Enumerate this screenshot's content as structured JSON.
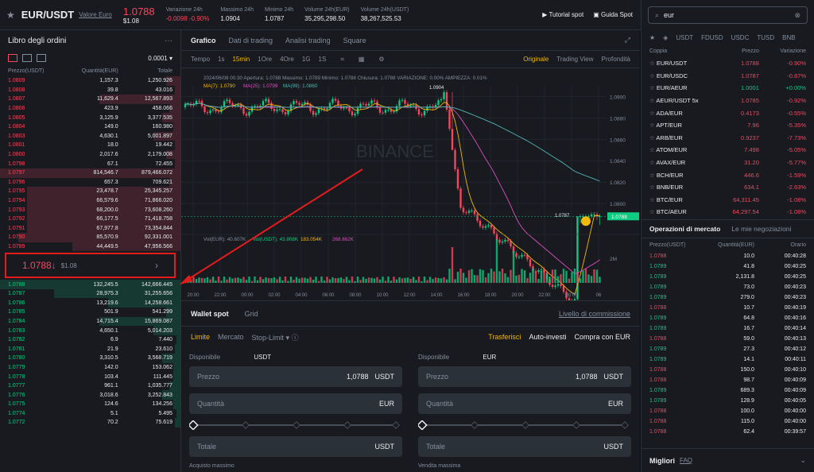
{
  "header": {
    "pair": "EUR/USDT",
    "pair_sub": "Valore Euro",
    "price": "1.0788",
    "price_usd": "$1.08",
    "stats": [
      {
        "label": "Variazione 24h",
        "value": "-0.0098 -0.90%",
        "color": "red"
      },
      {
        "label": "Massimo 24h",
        "value": "1.0904",
        "color": ""
      },
      {
        "label": "Minimo 24h",
        "value": "1.0787",
        "color": ""
      },
      {
        "label": "Volume 24h(EUR)",
        "value": "35,295,298.50",
        "color": ""
      },
      {
        "label": "Volume 24h(USDT)",
        "value": "38,267,525.53",
        "color": ""
      }
    ],
    "tutorial": "Tutorial spot",
    "guide": "Guida Spot"
  },
  "orderbook": {
    "title": "Libro degli ordini",
    "precision": "0.0001",
    "col_price": "Prezzo(USDT)",
    "col_qty": "Quantità(EUR)",
    "col_total": "Totale",
    "asks": [
      [
        "1.0809",
        "1,157.3",
        "1,250.926",
        8
      ],
      [
        "1.0808",
        "39.8",
        "43.016",
        3
      ],
      [
        "1.0807",
        "11,629.4",
        "12,567.893",
        45
      ],
      [
        "1.0806",
        "423.9",
        "458.066",
        6
      ],
      [
        "1.0805",
        "3,125.9",
        "3,377.535",
        10
      ],
      [
        "1.0804",
        "149.0",
        "160.980",
        4
      ],
      [
        "1.0803",
        "4,630.1",
        "5,001.897",
        15
      ],
      [
        "1.0801",
        "18.0",
        "19.442",
        3
      ],
      [
        "1.0800",
        "2,017.6",
        "2,179.008",
        8
      ],
      [
        "1.0798",
        "67.1",
        "72.455",
        3
      ],
      [
        "1.0797",
        "814,546.7",
        "879,466.072",
        100
      ],
      [
        "1.0796",
        "657.3",
        "709.621",
        6
      ],
      [
        "1.0795",
        "23,478.7",
        "25,345.257",
        85
      ],
      [
        "1.0794",
        "66,579.6",
        "71,866.020",
        85
      ],
      [
        "1.0793",
        "68,200.0",
        "73,608.260",
        85
      ],
      [
        "1.0792",
        "66,177.5",
        "71,418.758",
        85
      ],
      [
        "1.0791",
        "67,977.8",
        "73,354.844",
        85
      ],
      [
        "1.0790",
        "85,570.9",
        "92,331.001",
        90
      ],
      [
        "1.0789",
        "44,449.5",
        "47,956.566",
        60
      ]
    ],
    "mid_price": "1.0788",
    "mid_arrow": "↓",
    "mid_usd": "$1.08",
    "bids": [
      [
        "1.0788",
        "132,245.5",
        "142,666.445",
        100
      ],
      [
        "1.0787",
        "28,975.3",
        "31,255.656",
        70
      ],
      [
        "1.0786",
        "13,219.6",
        "14,258.661",
        40
      ],
      [
        "1.0785",
        "501.9",
        "541.299",
        8
      ],
      [
        "1.0784",
        "14,715.4",
        "15,869.087",
        45
      ],
      [
        "1.0783",
        "4,650.1",
        "5,014.203",
        15
      ],
      [
        "1.0782",
        "6.9",
        "7.440",
        2
      ],
      [
        "1.0781",
        "21.9",
        "23.610",
        3
      ],
      [
        "1.0780",
        "3,310.5",
        "3,568.719",
        10
      ],
      [
        "1.0779",
        "142.0",
        "153.062",
        4
      ],
      [
        "1.0778",
        "103.4",
        "111.445",
        4
      ],
      [
        "1.0777",
        "961.1",
        "1,035.777",
        6
      ],
      [
        "1.0776",
        "3,018.6",
        "3,252.843",
        10
      ],
      [
        "1.0775",
        "124.6",
        "134.256",
        4
      ],
      [
        "1.0774",
        "5.1",
        "5.495",
        2
      ],
      [
        "1.0772",
        "70.2",
        "75.619",
        3
      ]
    ]
  },
  "chart_panel": {
    "tabs": [
      "Grafico",
      "Dati di trading",
      "Analisi trading",
      "Square"
    ],
    "intervals": [
      "Tempo",
      "1s",
      "15min",
      "1Ore",
      "4Ore",
      "1G",
      "1S"
    ],
    "views": [
      "Originale",
      "Trading View",
      "Profondità"
    ],
    "ohlc_line": "2024/06/08 00:30  Apertura: 1.0788  Massimo: 1.0789  Minimo: 1.0788  Chiusura: 1.0788  VARIAZIONE: 0.00%  AMPIEZZA: 0.01%",
    "ma_line": [
      "MA(7): 1.0790",
      "MA(25): 1.0799",
      "MA(99): 1.0860"
    ],
    "vol_line": [
      "Vol(EUR): 40.607K",
      "Vol(USDT): 43.808K",
      "183.054K",
      "268.862K"
    ],
    "watermark": "BINANCE",
    "price_ticks": [
      "1.0900",
      "1.0880",
      "1.0860",
      "1.0840",
      "1.0820",
      "1.0800"
    ],
    "last_price_tag": "1.0788",
    "high_label": "1.0904",
    "low_label": "1.0787",
    "vol_tick": "2M",
    "time_ticks": [
      "20:00",
      "22:00",
      "00:00",
      "02:00",
      "04:00",
      "06:00",
      "08:00",
      "10:00",
      "12:00",
      "14:00",
      "16:00",
      "18:00",
      "20:00",
      "22:00",
      "00:00",
      "06"
    ]
  },
  "chart_data": {
    "type": "line",
    "series": [],
    "ma_colors": {
      "ma7": "#f0b90b",
      "ma25": "#d84fbd",
      "ma99": "#4fb6b1"
    }
  },
  "trade": {
    "tabs": [
      "Wallet spot",
      "Grid"
    ],
    "commission": "Livello di commissione",
    "order_types": [
      "Limite",
      "Mercato",
      "Stop-Limit"
    ],
    "transfer": "Trasferisci",
    "auto": "Auto-investi",
    "buy_eur": "Compra con EUR",
    "buy": {
      "avail_label": "Disponibile",
      "avail_unit": "USDT",
      "price_label": "Prezzo",
      "price": "1,0788",
      "price_unit": "USDT",
      "qty_label": "Quantità",
      "qty_unit": "EUR",
      "total_label": "Totale",
      "total_unit": "USDT",
      "max_label": "Acquisto massimo"
    },
    "sell": {
      "avail_label": "Disponibile",
      "avail_unit": "EUR",
      "price_label": "Prezzo",
      "price": "1,0788",
      "price_unit": "USDT",
      "qty_label": "Quantità",
      "qty_unit": "EUR",
      "total_label": "Totale",
      "total_unit": "USDT",
      "max_label": "Vendita massima"
    }
  },
  "market": {
    "search": "eur",
    "tabs": [
      "USDT",
      "FDUSD",
      "USDC",
      "TUSD",
      "BNB"
    ],
    "col_pair": "Coppia",
    "col_price": "Prezzo",
    "col_change": "Variazione",
    "rows": [
      [
        "EUR/USDT",
        "1.0788",
        "-0.90%",
        "red"
      ],
      [
        "EUR/USDC",
        "1.0787",
        "-0.87%",
        "red"
      ],
      [
        "EUR/AEUR",
        "1.0001",
        "+0.00%",
        "green"
      ],
      [
        "AEUR/USDT 5x",
        "1.0785",
        "-0.92%",
        "red"
      ],
      [
        "ADA/EUR",
        "0.4173",
        "-0.55%",
        "red"
      ],
      [
        "APT/EUR",
        "7.96",
        "-5.35%",
        "red"
      ],
      [
        "ARB/EUR",
        "0.9237",
        "-7.73%",
        "red"
      ],
      [
        "ATOM/EUR",
        "7.498",
        "-5.05%",
        "red"
      ],
      [
        "AVAX/EUR",
        "31.20",
        "-5.77%",
        "red"
      ],
      [
        "BCH/EUR",
        "446.6",
        "-1.59%",
        "red"
      ],
      [
        "BNB/EUR",
        "634.1",
        "-2.63%",
        "red"
      ],
      [
        "BTC/EUR",
        "64,311.45",
        "-1.08%",
        "red"
      ],
      [
        "BTC/AEUR",
        "64,297.54",
        "-1.08%",
        "red"
      ]
    ],
    "trades_tabs": [
      "Operazioni di mercato",
      "Le mie negoziazioni"
    ],
    "trades_cols": [
      "Prezzo(USDT)",
      "Quantità(EUR)",
      "Orario"
    ],
    "trades": [
      [
        "1.0788",
        "10.0",
        "00:40:28",
        "red"
      ],
      [
        "1.0789",
        "41.8",
        "00:40:25",
        "green"
      ],
      [
        "1.0789",
        "2,131.8",
        "00:40:25",
        "green"
      ],
      [
        "1.0789",
        "73.0",
        "00:40:23",
        "green"
      ],
      [
        "1.0789",
        "279.0",
        "00:40:23",
        "green"
      ],
      [
        "1.0788",
        "10.7",
        "00:40:19",
        "red"
      ],
      [
        "1.0789",
        "64.8",
        "00:40:16",
        "green"
      ],
      [
        "1.0789",
        "16.7",
        "00:40:14",
        "green"
      ],
      [
        "1.0788",
        "59.0",
        "00:40:13",
        "red"
      ],
      [
        "1.0789",
        "27.3",
        "00:40:12",
        "green"
      ],
      [
        "1.0789",
        "14.1",
        "00:40:11",
        "green"
      ],
      [
        "1.0788",
        "150.0",
        "00:40:10",
        "red"
      ],
      [
        "1.0788",
        "98.7",
        "00:40:09",
        "red"
      ],
      [
        "1.0789",
        "689.3",
        "00:40:09",
        "green"
      ],
      [
        "1.0789",
        "128.9",
        "00:40:05",
        "green"
      ],
      [
        "1.0788",
        "100.0",
        "00:40:00",
        "red"
      ],
      [
        "1.0788",
        "115.0",
        "00:40:00",
        "red"
      ],
      [
        "1.0788",
        "62.4",
        "00:39:57",
        "red"
      ]
    ],
    "footer": "Migliori",
    "footer_faq": "FAQ"
  }
}
